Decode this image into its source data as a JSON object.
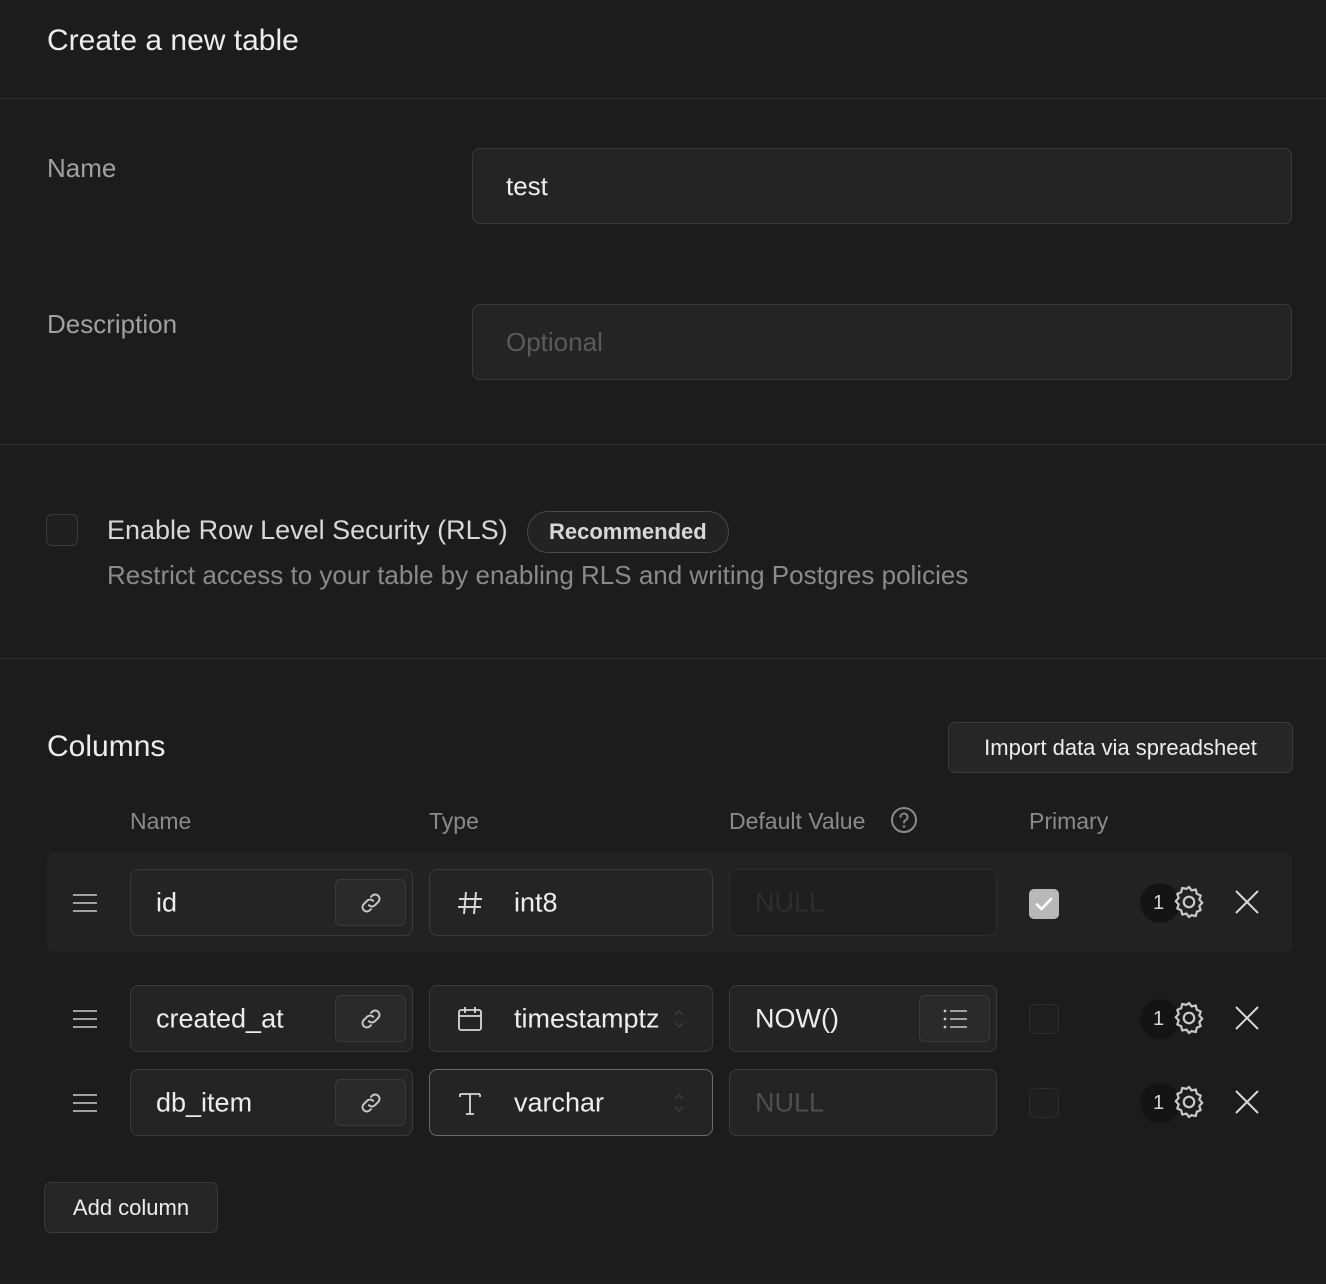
{
  "header": {
    "title": "Create a new table"
  },
  "form": {
    "name_label": "Name",
    "name_value": "test",
    "description_label": "Description",
    "description_placeholder": "Optional"
  },
  "rls": {
    "label": "Enable Row Level Security (RLS)",
    "badge": "Recommended",
    "description": "Restrict access to your table by enabling RLS and writing Postgres policies",
    "checked": false
  },
  "columns": {
    "title": "Columns",
    "import_button": "Import data via spreadsheet",
    "headers": {
      "name": "Name",
      "type": "Type",
      "default": "Default Value",
      "primary": "Primary"
    },
    "rows": [
      {
        "name": "id",
        "type": "int8",
        "type_icon": "hash-icon",
        "default": "NULL",
        "primary": true,
        "count": "1"
      },
      {
        "name": "created_at",
        "type": "timestamptz",
        "type_icon": "calendar-icon",
        "default": "NOW()",
        "primary": false,
        "count": "1"
      },
      {
        "name": "db_item",
        "type": "varchar",
        "type_icon": "text-type-icon",
        "default": "NULL",
        "primary": false,
        "count": "1"
      }
    ],
    "add_button": "Add column"
  }
}
